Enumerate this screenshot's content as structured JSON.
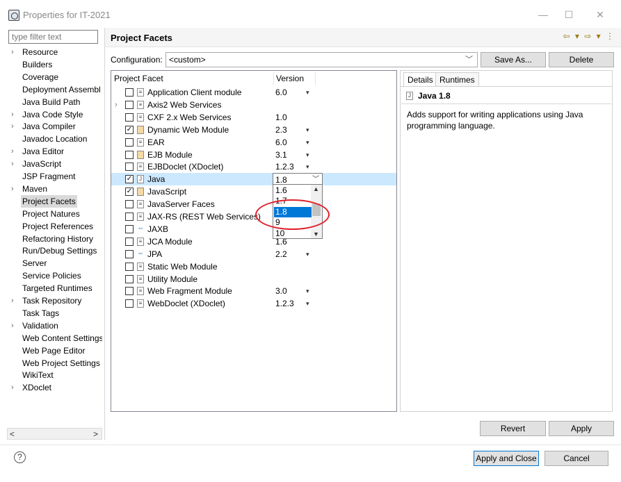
{
  "window": {
    "title": "Properties for IT-2021",
    "minimize": "—",
    "maximize": "☐",
    "close": "✕"
  },
  "filter": {
    "placeholder": "type filter text"
  },
  "nav": {
    "items": [
      {
        "label": "Resource",
        "expandable": true
      },
      {
        "label": "Builders",
        "expandable": false
      },
      {
        "label": "Coverage",
        "expandable": false
      },
      {
        "label": "Deployment Assembl",
        "expandable": false
      },
      {
        "label": "Java Build Path",
        "expandable": false
      },
      {
        "label": "Java Code Style",
        "expandable": true
      },
      {
        "label": "Java Compiler",
        "expandable": true
      },
      {
        "label": "Javadoc Location",
        "expandable": false
      },
      {
        "label": "Java Editor",
        "expandable": true
      },
      {
        "label": "JavaScript",
        "expandable": true
      },
      {
        "label": "JSP Fragment",
        "expandable": false
      },
      {
        "label": "Maven",
        "expandable": true
      },
      {
        "label": "Project Facets",
        "expandable": false,
        "selected": true
      },
      {
        "label": "Project Natures",
        "expandable": false
      },
      {
        "label": "Project References",
        "expandable": false
      },
      {
        "label": "Refactoring History",
        "expandable": false
      },
      {
        "label": "Run/Debug Settings",
        "expandable": false
      },
      {
        "label": "Server",
        "expandable": false
      },
      {
        "label": "Service Policies",
        "expandable": false
      },
      {
        "label": "Targeted Runtimes",
        "expandable": false
      },
      {
        "label": "Task Repository",
        "expandable": true
      },
      {
        "label": "Task Tags",
        "expandable": false
      },
      {
        "label": "Validation",
        "expandable": true
      },
      {
        "label": "Web Content Settings",
        "expandable": false
      },
      {
        "label": "Web Page Editor",
        "expandable": false
      },
      {
        "label": "Web Project Settings",
        "expandable": false
      },
      {
        "label": "WikiText",
        "expandable": false
      },
      {
        "label": "XDoclet",
        "expandable": true
      }
    ],
    "scroll_left": "<",
    "scroll_right": ">"
  },
  "page": {
    "title": "Project Facets",
    "tools": "⇦ ▾ ⇨ ▾ ⋮"
  },
  "configuration": {
    "label": "Configuration:",
    "value": "<custom>",
    "save_as": "Save As...",
    "delete": "Delete"
  },
  "facets": {
    "col_facet": "Project Facet",
    "col_version": "Version",
    "rows": [
      {
        "name": "Application Client module",
        "version": "6.0",
        "checked": false,
        "dropdown": true,
        "icon": "doc"
      },
      {
        "name": "Axis2 Web Services",
        "version": "",
        "checked": false,
        "expandable": true,
        "icon": "doc"
      },
      {
        "name": "CXF 2.x Web Services",
        "version": "1.0",
        "checked": false,
        "icon": "doc"
      },
      {
        "name": "Dynamic Web Module",
        "version": "2.3",
        "checked": true,
        "dropdown": true,
        "icon": "gear"
      },
      {
        "name": "EAR",
        "version": "6.0",
        "checked": false,
        "dropdown": true,
        "icon": "doc"
      },
      {
        "name": "EJB Module",
        "version": "3.1",
        "checked": false,
        "dropdown": true,
        "icon": "gear"
      },
      {
        "name": "EJBDoclet (XDoclet)",
        "version": "1.2.3",
        "checked": false,
        "dropdown": true,
        "icon": "doc"
      },
      {
        "name": "Java",
        "version": "1.8",
        "checked": true,
        "selected": true,
        "icon": "java"
      },
      {
        "name": "JavaScript",
        "version": "",
        "checked": true,
        "icon": "gear"
      },
      {
        "name": "JavaServer Faces",
        "version": "",
        "checked": false,
        "icon": "doc"
      },
      {
        "name": "JAX-RS (REST Web Services)",
        "version": "",
        "checked": false,
        "icon": "doc"
      },
      {
        "name": "JAXB",
        "version": "",
        "checked": false,
        "icon": "plug"
      },
      {
        "name": "JCA Module",
        "version": "1.6",
        "checked": false,
        "icon": "doc"
      },
      {
        "name": "JPA",
        "version": "2.2",
        "checked": false,
        "dropdown": true,
        "icon": "plug"
      },
      {
        "name": "Static Web Module",
        "version": "",
        "checked": false,
        "icon": "doc"
      },
      {
        "name": "Utility Module",
        "version": "",
        "checked": false,
        "icon": "doc"
      },
      {
        "name": "Web Fragment Module",
        "version": "3.0",
        "checked": false,
        "dropdown": true,
        "icon": "doc"
      },
      {
        "name": "WebDoclet (XDoclet)",
        "version": "1.2.3",
        "checked": false,
        "dropdown": true,
        "icon": "doc"
      }
    ]
  },
  "version_dropdown": {
    "options": [
      "1.6",
      "1.7",
      "1.8",
      "9",
      "10"
    ],
    "highlighted": "1.8"
  },
  "details": {
    "tab_details": "Details",
    "tab_runtimes": "Runtimes",
    "title": "Java 1.8",
    "description": "Adds support for writing applications using Java programming language."
  },
  "buttons": {
    "revert": "Revert",
    "apply": "Apply",
    "apply_and_close": "Apply and Close",
    "cancel": "Cancel",
    "help": "?"
  },
  "colors": {
    "selection": "#cce8ff",
    "highlight": "#0078d7",
    "annotation_ring": "#e0202a"
  }
}
